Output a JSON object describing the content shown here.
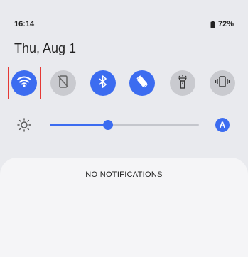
{
  "status_bar": {
    "time": "16:14",
    "battery_percent": "72%",
    "battery_icon": "battery-icon"
  },
  "header": {
    "date": "Thu, Aug 1"
  },
  "quick_tiles": [
    {
      "name": "wifi",
      "icon": "wifi-icon",
      "state": "on"
    },
    {
      "name": "mobile-data",
      "icon": "mobile-data-off-icon",
      "state": "off"
    },
    {
      "name": "bluetooth",
      "icon": "bluetooth-icon",
      "state": "on"
    },
    {
      "name": "auto-rotate",
      "icon": "rotate-icon",
      "state": "on"
    },
    {
      "name": "flashlight",
      "icon": "flashlight-icon",
      "state": "off"
    },
    {
      "name": "vibrate",
      "icon": "vibrate-icon",
      "state": "off"
    }
  ],
  "brightness": {
    "level": 0.39,
    "auto_label": "A"
  },
  "notifications": {
    "empty_text": "NO NOTIFICATIONS"
  },
  "colors": {
    "accent": "#3c6cf0",
    "inactive_tile": "#c9cacf",
    "background": "#e9eaee",
    "highlight": "#e53935"
  }
}
